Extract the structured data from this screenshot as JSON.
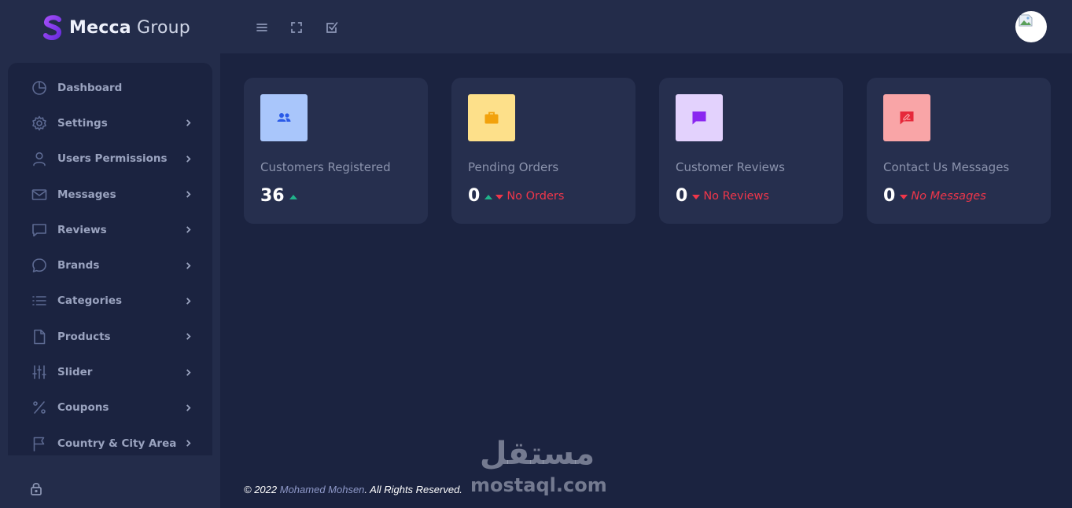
{
  "brand": {
    "name_bold": "Mecca",
    "name_light": "Group",
    "logo_color": "#8b3df2"
  },
  "topbar": {
    "icons": [
      "menu-icon",
      "fullscreen-icon",
      "checkbox-icon"
    ],
    "avatar": "user-avatar"
  },
  "sidebar": {
    "items": [
      {
        "label": "Dashboard",
        "icon": "pie-chart-icon",
        "has_submenu": false
      },
      {
        "label": "Settings",
        "icon": "gear-icon",
        "has_submenu": true
      },
      {
        "label": "Users Permissions",
        "icon": "user-icon",
        "has_submenu": true
      },
      {
        "label": "Messages",
        "icon": "mail-icon",
        "has_submenu": true
      },
      {
        "label": "Reviews",
        "icon": "comment-square-icon",
        "has_submenu": true
      },
      {
        "label": "Brands",
        "icon": "chat-bubble-icon",
        "has_submenu": true
      },
      {
        "label": "Categories",
        "icon": "list-icon",
        "has_submenu": true
      },
      {
        "label": "Products",
        "icon": "file-icon",
        "has_submenu": true
      },
      {
        "label": "Slider",
        "icon": "sliders-icon",
        "has_submenu": true
      },
      {
        "label": "Coupons",
        "icon": "percent-icon",
        "has_submenu": true
      },
      {
        "label": "Country & City Area",
        "icon": "flag-icon",
        "has_submenu": true
      }
    ],
    "lock_icon": "lock-icon"
  },
  "cards": [
    {
      "title": "Customers Registered",
      "value": "36",
      "trend": "up",
      "note": "",
      "icon": "users-icon",
      "icon_bg": "#a9c6fb",
      "icon_color": "#2a5ae8"
    },
    {
      "title": "Pending Orders",
      "value": "0",
      "trend": "up-down",
      "note": "No Orders",
      "icon": "briefcase-icon",
      "icon_bg": "#fde08a",
      "icon_color": "#f2a20c"
    },
    {
      "title": "Customer Reviews",
      "value": "0",
      "trend": "down",
      "note": "No Reviews",
      "icon": "message-icon",
      "icon_bg": "#e3d2fd",
      "icon_color": "#8a27f0"
    },
    {
      "title": "Contact Us Messages",
      "value": "0",
      "trend": "down",
      "note": "No Messages",
      "icon": "message-edit-icon",
      "icon_bg": "#f9a5a7",
      "icon_color": "#e6283a"
    }
  ],
  "footer": {
    "prefix": "© 2022 ",
    "author": "Mohamed Mohsen",
    "suffix": ". All Rights Reserved."
  },
  "watermark": {
    "arabic": "مستقل",
    "latin": "mostaql.com"
  }
}
